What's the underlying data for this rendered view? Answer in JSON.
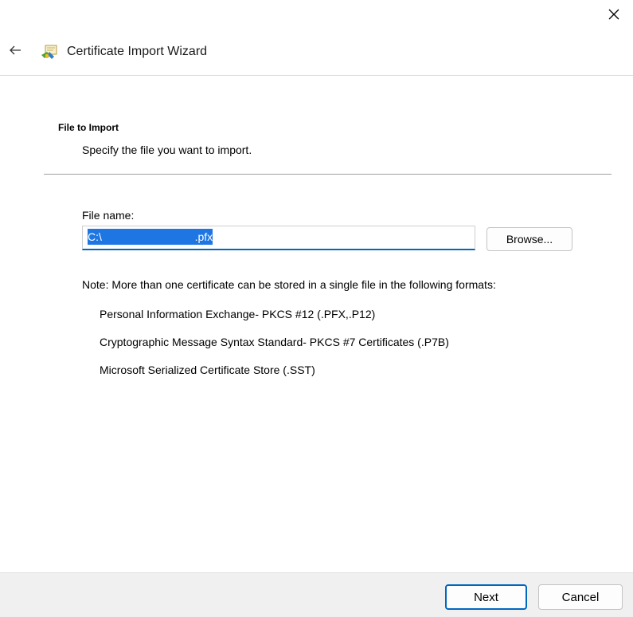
{
  "window": {
    "title": "Certificate Import Wizard",
    "close_icon": "close-icon",
    "back_icon": "back-arrow-icon",
    "app_icon": "certificate-icon"
  },
  "section": {
    "heading": "File to Import",
    "description": "Specify the file you want to import."
  },
  "file": {
    "label": "File name:",
    "value": "C:\\                              .pfx",
    "browse_label": "Browse..."
  },
  "note": "Note:  More than one certificate can be stored in a single file in the following formats:",
  "formats": [
    "Personal Information Exchange- PKCS #12 (.PFX,.P12)",
    "Cryptographic Message Syntax Standard- PKCS #7 Certificates (.P7B)",
    "Microsoft Serialized Certificate Store (.SST)"
  ],
  "footer": {
    "next_label": "Next",
    "cancel_label": "Cancel"
  },
  "colors": {
    "accent": "#0067c0",
    "selection": "#1e76e3",
    "footer_bg": "#f0f0f0"
  }
}
